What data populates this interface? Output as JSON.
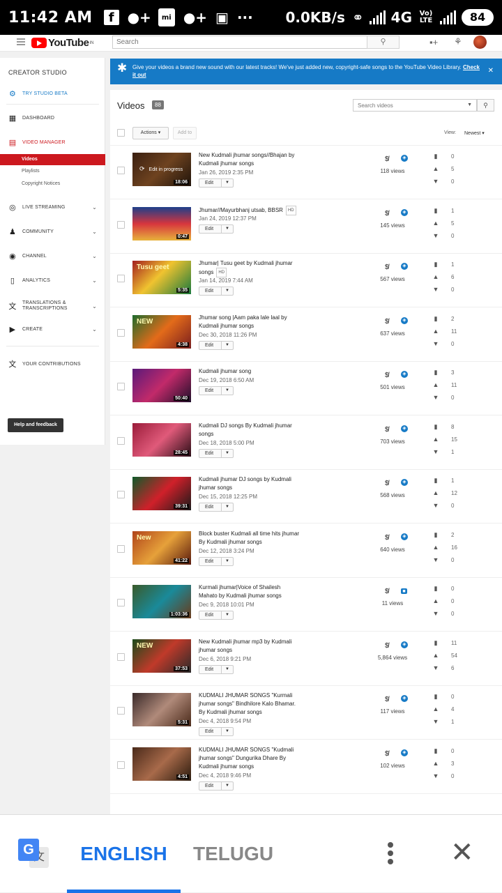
{
  "status_bar": {
    "time": "11:42 AM",
    "speed": "0.0KB/s",
    "network": "4G",
    "volte": "Vo) LTE",
    "battery": "84"
  },
  "masthead": {
    "logo_text": "YouTube",
    "logo_sup": "IN",
    "search_placeholder": "Search"
  },
  "sidebar": {
    "title": "CREATOR STUDIO",
    "items": [
      {
        "label": "TRY STUDIO BETA",
        "icon": "gear-icon"
      },
      {
        "label": "DASHBOARD",
        "icon": "dashboard-icon"
      },
      {
        "label": "VIDEO MANAGER",
        "icon": "video-manager-icon"
      },
      {
        "label": "LIVE STREAMING",
        "icon": "live-icon"
      },
      {
        "label": "COMMUNITY",
        "icon": "community-icon"
      },
      {
        "label": "CHANNEL",
        "icon": "channel-icon"
      },
      {
        "label": "ANALYTICS",
        "icon": "analytics-icon"
      },
      {
        "label": "TRANSLATIONS & TRANSCRIPTIONS",
        "icon": "translate-icon"
      },
      {
        "label": "CREATE",
        "icon": "create-icon"
      },
      {
        "label": "YOUR CONTRIBUTIONS",
        "icon": "contributions-icon"
      }
    ],
    "subitems": [
      "Videos",
      "Playlists",
      "Copyright Notices"
    ],
    "help_button": "Help and feedback"
  },
  "banner": {
    "text": "Give your videos a brand new sound with our latest tracks! We've just added new, copyright-safe songs to the YouTube Video Library.",
    "link": "Check it out"
  },
  "main": {
    "title": "Videos",
    "count": "88",
    "search_placeholder": "Search videos",
    "actions_label": "Actions",
    "add_to_label": "Add to",
    "view_label": "View:",
    "sort_label": "Newest",
    "edit_label": "Edit",
    "videos": [
      {
        "title": "New Kudmali jhumar songs//Bhajan by Kudmali jhumar songs",
        "hd": false,
        "date": "Jan 26, 2019 2:35 PM",
        "views": "118 views",
        "comments": "0",
        "likes": "5",
        "dislikes": "0",
        "duration": "18:06",
        "processing": "Edit in progress",
        "visibility": "public",
        "thumb_text": ""
      },
      {
        "title": "Jhumar//Mayurbhanj utsab, BBSR",
        "hd": true,
        "date": "Jan 24, 2019 12:37 PM",
        "views": "145 views",
        "comments": "1",
        "likes": "5",
        "dislikes": "0",
        "duration": "0:47",
        "processing": "",
        "visibility": "public",
        "thumb_text": ""
      },
      {
        "title": "Jhumar| Tusu geet by Kudmali jhumar songs",
        "hd": true,
        "date": "Jan 14, 2019 7:44 AM",
        "views": "567 views",
        "comments": "1",
        "likes": "6",
        "dislikes": "0",
        "duration": "5:35",
        "processing": "",
        "visibility": "public",
        "thumb_text": "Tusu geet"
      },
      {
        "title": "Jhumar song |Aam paka lale laal by Kudmali jhumar songs",
        "hd": false,
        "date": "Dec 30, 2018 11:26 PM",
        "views": "637 views",
        "comments": "2",
        "likes": "11",
        "dislikes": "0",
        "duration": "4:38",
        "processing": "",
        "visibility": "public",
        "thumb_text": "NEW"
      },
      {
        "title": "Kudmali jhumar song",
        "hd": false,
        "date": "Dec 19, 2018 6:50 AM",
        "views": "501 views",
        "comments": "3",
        "likes": "11",
        "dislikes": "0",
        "duration": "50:40",
        "processing": "",
        "visibility": "public",
        "thumb_text": ""
      },
      {
        "title": "Kudmali DJ songs By Kudmali jhumar songs",
        "hd": false,
        "date": "Dec 18, 2018 5:00 PM",
        "views": "703 views",
        "comments": "8",
        "likes": "15",
        "dislikes": "1",
        "duration": "28:45",
        "processing": "",
        "visibility": "public",
        "thumb_text": ""
      },
      {
        "title": "Kudmali jhumar DJ songs by Kudmali jhumar songs",
        "hd": false,
        "date": "Dec 15, 2018 12:25 PM",
        "views": "568 views",
        "comments": "1",
        "likes": "12",
        "dislikes": "0",
        "duration": "39:31",
        "processing": "",
        "visibility": "public",
        "thumb_text": ""
      },
      {
        "title": "Block buster Kudmali all time hits jhumar By Kudmali jhumar songs",
        "hd": false,
        "date": "Dec 12, 2018 3:24 PM",
        "views": "640 views",
        "comments": "2",
        "likes": "16",
        "dislikes": "0",
        "duration": "41:22",
        "processing": "",
        "visibility": "public",
        "thumb_text": "New"
      },
      {
        "title": "Kurmali jhumar|Voice of Shailesh Mahato by Kudmali jhumar songs",
        "hd": false,
        "date": "Dec 9, 2018 10:01 PM",
        "views": "11 views",
        "comments": "0",
        "likes": "0",
        "dislikes": "0",
        "duration": "1:03:36",
        "processing": "",
        "visibility": "private",
        "thumb_text": ""
      },
      {
        "title": "New Kudmali jhumar mp3 by Kudmali jhumar songs",
        "hd": false,
        "date": "Dec 6, 2018 9:21 PM",
        "views": "5,864 views",
        "comments": "11",
        "likes": "54",
        "dislikes": "6",
        "duration": "37:53",
        "processing": "",
        "visibility": "public",
        "thumb_text": "NEW"
      },
      {
        "title": "KUDMALI JHUMAR SONGS \"Kurmali jhumar songs\" Bindhilore Kalo Bhamar. By Kudmali jhumar songs",
        "hd": false,
        "date": "Dec 4, 2018 9:54 PM",
        "views": "117 views",
        "comments": "0",
        "likes": "4",
        "dislikes": "1",
        "duration": "5:31",
        "processing": "",
        "visibility": "public",
        "thumb_text": ""
      },
      {
        "title": "KUDMALI JHUMAR SONGS \"Kudmali jhumar songs\" Dungurika Dhare By Kudmali jhumar songs",
        "hd": false,
        "date": "Dec 4, 2018 9:46 PM",
        "views": "102 views",
        "comments": "0",
        "likes": "3",
        "dislikes": "0",
        "duration": "4:51",
        "processing": "",
        "visibility": "public",
        "thumb_text": ""
      }
    ]
  },
  "translate_bar": {
    "lang_active": "ENGLISH",
    "lang_other": "TELUGU"
  },
  "colors": {
    "accent_blue": "#167ac6",
    "accent_red": "#cc181e",
    "translate_blue": "#1a73e8"
  }
}
